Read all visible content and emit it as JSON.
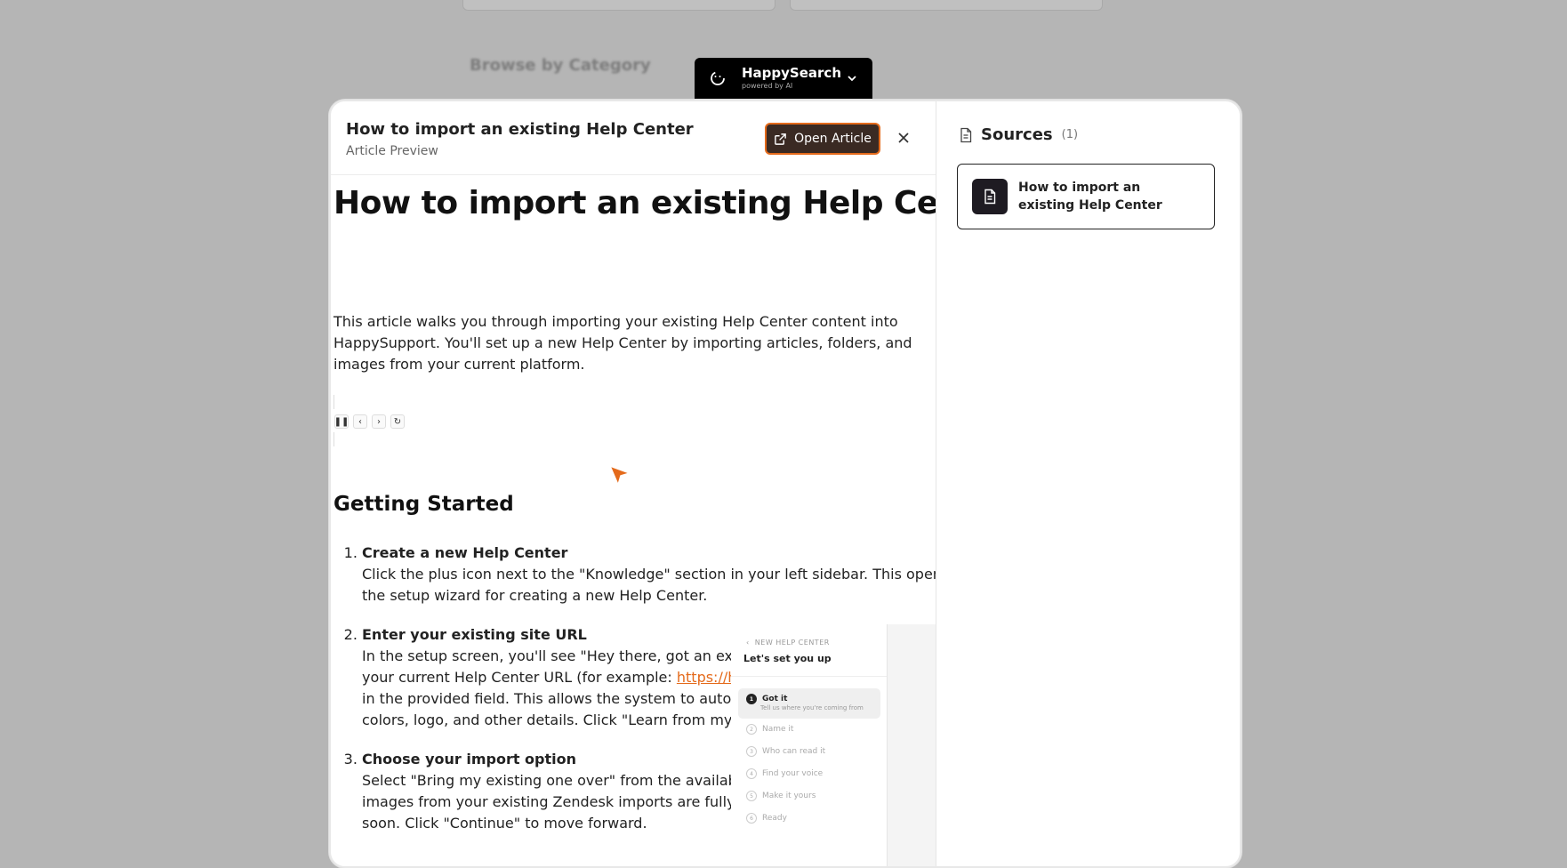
{
  "background": {
    "heading": "Browse by Category"
  },
  "widget": {
    "name": "HappySearch",
    "tagline": "powered by AI"
  },
  "preview": {
    "title": "How to import an existing Help Center",
    "subtitle": "Article Preview",
    "open_label": "Open Article"
  },
  "article": {
    "heading": "How to import an existing Help Center",
    "intro": "This article walks you through importing your existing Help Center content into HappySupport. You'll set up a new Help Center by importing articles, folders, and images from your current platform.",
    "section_heading": "Getting Started",
    "steps": [
      {
        "title": "Create a new Help Center",
        "body": "Click the plus icon next to the \"Knowledge\" section in your left sidebar. This opens the setup wizard for creating a new Help Center."
      },
      {
        "title": "Enter your existing site URL",
        "body_before": "In the setup screen, you'll see \"Hey there, got an existing site I can peek at?\" Enter your current Help Center URL (for example: ",
        "link": "https://helpcenter.neuroflash.com/en",
        "body_after": ") in the provided field. This allows the system to automatically detect your brand colors, logo, and other details. Click \"Learn from my si"
      },
      {
        "title": "Choose your import option",
        "body": "Select \"Bring my existing one over\" from the available pull in articles, folders, and images from your existing Zendesk imports are fully supported, with Intercom an soon. Click \"Continue\" to move forward."
      }
    ]
  },
  "embedded_screenshot": {
    "back_label": "NEW HELP CENTER",
    "title": "Let's set you up",
    "steps": [
      {
        "num": "1",
        "label": "Got it",
        "hint": "Tell us where you're coming from"
      },
      {
        "num": "2",
        "label": "Name it"
      },
      {
        "num": "3",
        "label": "Who can read it"
      },
      {
        "num": "4",
        "label": "Find your voice"
      },
      {
        "num": "5",
        "label": "Make it yours"
      },
      {
        "num": "6",
        "label": "Ready"
      }
    ]
  },
  "sources": {
    "title": "Sources",
    "count": "(1)",
    "items": [
      {
        "label": "How to import an existing Help Center"
      }
    ]
  },
  "colors": {
    "accent": "#e46a1b",
    "button_bg": "#3a2a23",
    "overlay": "#b5b5b5"
  }
}
